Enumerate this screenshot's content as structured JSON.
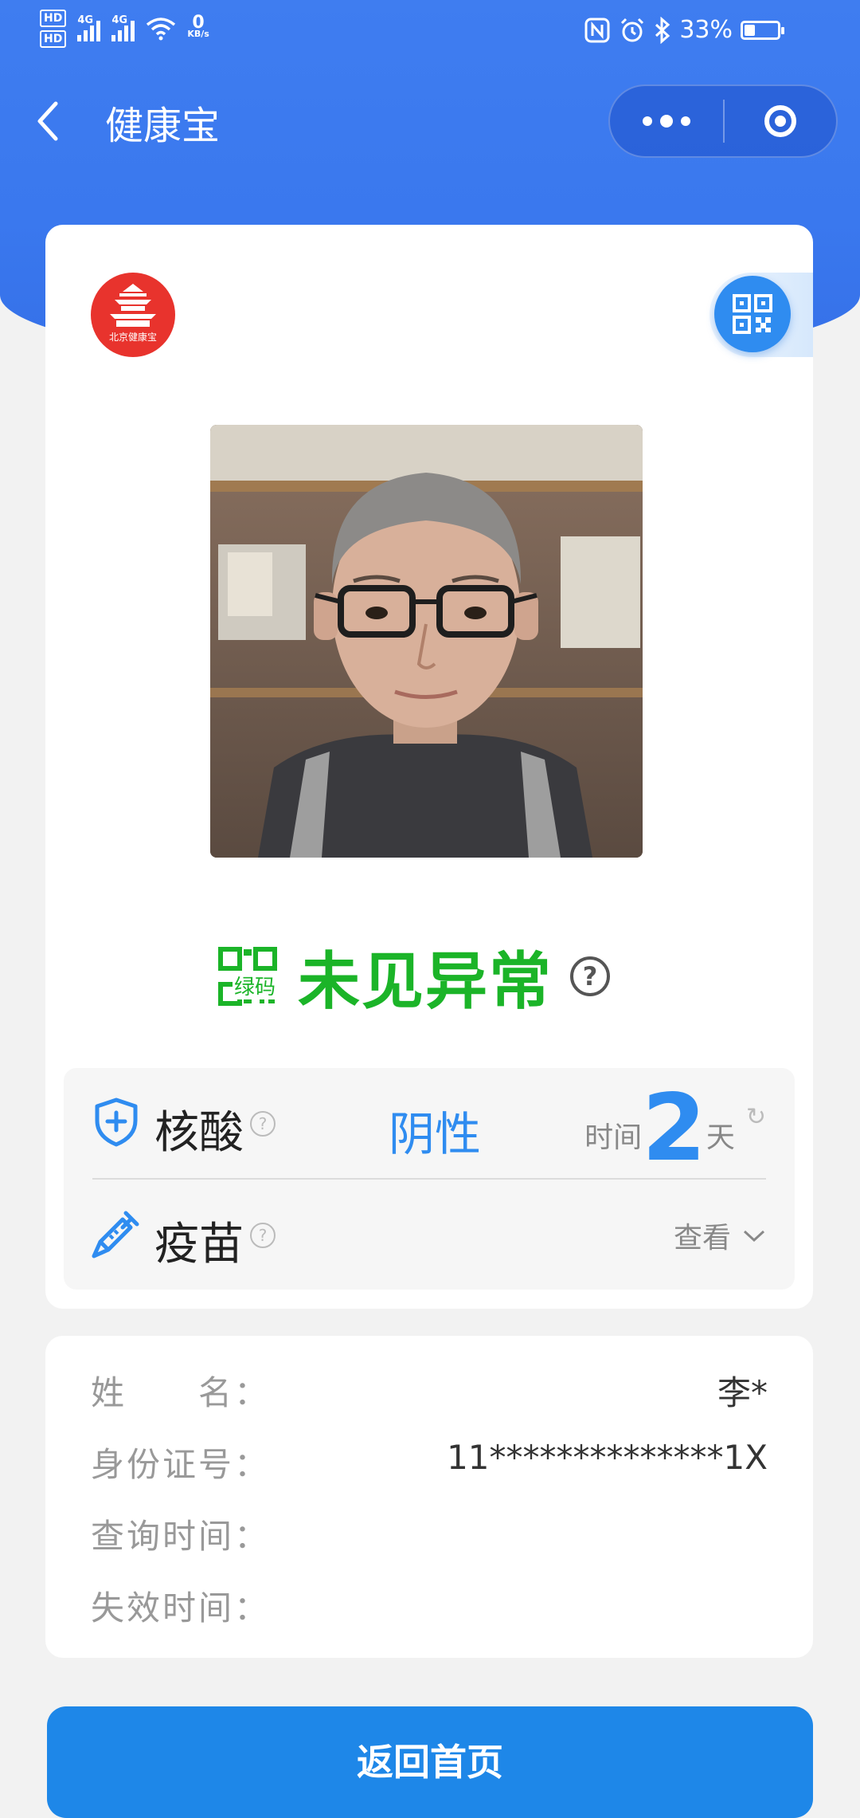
{
  "status_bar": {
    "hd1": "HD",
    "hd2": "HD",
    "net_type_1": "4G",
    "net_type_2": "4G",
    "net_speed_value": "0",
    "net_speed_unit": "KB/s",
    "battery_percent": "33%",
    "battery_level": 0.33
  },
  "nav": {
    "title": "健康宝"
  },
  "card": {
    "logo_text": "北京健康宝",
    "green_code_label": "绿码",
    "status_text": "未见异常",
    "help_symbol": "?",
    "nucleic_acid": {
      "label": "核酸",
      "result": "阴性",
      "time_label": "时间",
      "time_value": "2",
      "time_unit": "天",
      "refresh_symbol": "↻"
    },
    "vaccine": {
      "label": "疫苗",
      "view_label": "查看"
    }
  },
  "info": {
    "rows": [
      {
        "label": "姓　　名：",
        "value": "李*"
      },
      {
        "label": "身份证号：",
        "value": "11**************1X"
      },
      {
        "label": "查询时间：",
        "value": ""
      },
      {
        "label": "失效时间：",
        "value": ""
      }
    ]
  },
  "buttons": {
    "home": "返回首页"
  },
  "colors": {
    "header_blue": "#3f7df0",
    "green_status": "#1bb428",
    "accent_blue": "#2f8cf0",
    "logo_red": "#e8332d",
    "button_blue": "#1e87e8"
  }
}
